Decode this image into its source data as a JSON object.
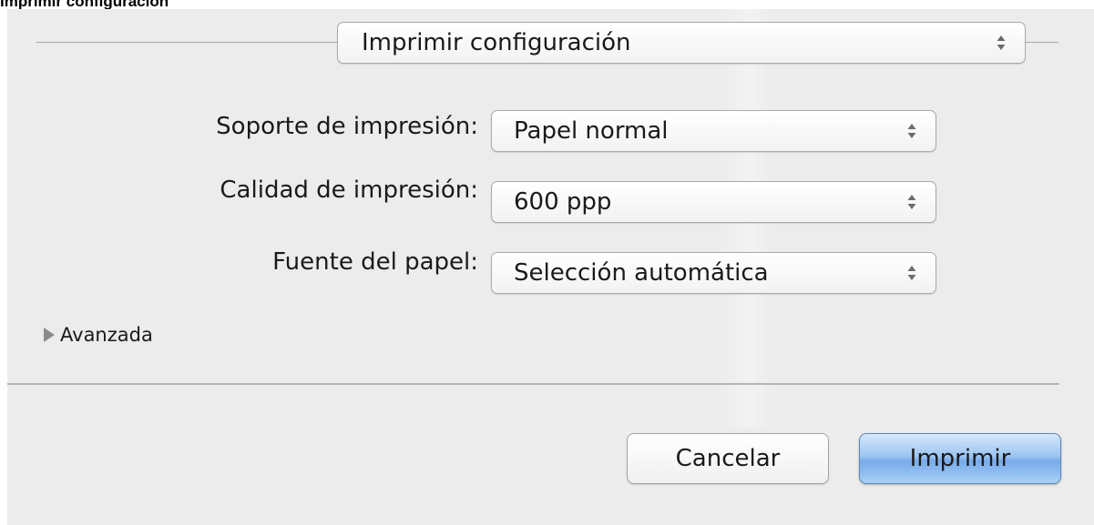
{
  "caption": "Imprimir configuración",
  "panel_select": {
    "value": "Imprimir configuración",
    "icon": "up-down-arrows-icon"
  },
  "settings": [
    {
      "label": "Soporte de impresión:",
      "value": "Papel normal"
    },
    {
      "label": "Calidad de impresión:",
      "value": "600 ppp"
    },
    {
      "label": "Fuente del papel:",
      "value": "Selección automática"
    }
  ],
  "advanced": {
    "label": "Avanzada",
    "icon": "disclosure-triangle-icon",
    "expanded": false
  },
  "buttons": {
    "cancel": "Cancelar",
    "print": "Imprimir"
  },
  "colors": {
    "dialog_background": "#ececec",
    "default_button": "#8fbdee"
  }
}
